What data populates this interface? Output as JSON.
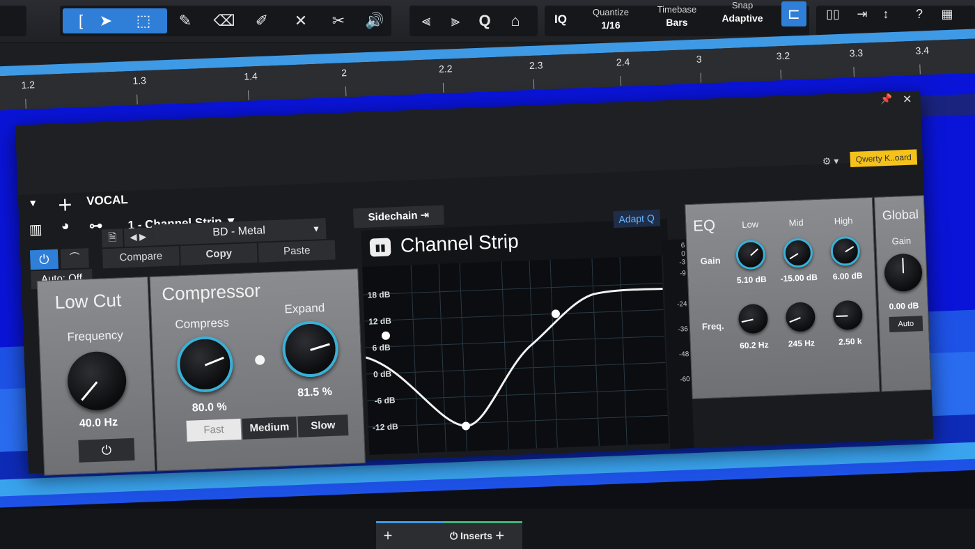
{
  "toolbar": {
    "quantize_label": "Quantize",
    "quantize_value": "1/16",
    "timebase_label": "Timebase",
    "timebase_value": "Bars",
    "snap_label": "Snap",
    "snap_value": "Adaptive",
    "iq_label": "IQ",
    "q_label": "Q"
  },
  "ruler": {
    "marks": [
      "1.2",
      "1.3",
      "1.4",
      "2",
      "2.2",
      "2.3",
      "2.4",
      "3",
      "3.2",
      "3.3",
      "3.4"
    ]
  },
  "plugin": {
    "track_name": "VOCAL",
    "plugin_selector": "1 - Channel Strip",
    "preset_name": "BD - Metal",
    "compare_label": "Compare",
    "copy_label": "Copy",
    "paste_label": "Paste",
    "auto_label": "Auto: Off",
    "sidechain_label": "Sidechain",
    "keyboard_badge": "Qwerty K..oard",
    "title": "Channel Strip",
    "adapt_q_label": "Adapt Q",
    "low_cut": {
      "title": "Low Cut",
      "frequency_label": "Frequency",
      "frequency_value": "40.0 Hz"
    },
    "compressor": {
      "title": "Compressor",
      "compress_label": "Compress",
      "compress_value": "80.0 %",
      "expand_label": "Expand",
      "expand_value": "81.5 %",
      "modes": [
        "Fast",
        "Medium",
        "Slow"
      ],
      "selected_mode": "Fast"
    },
    "eq_graph": {
      "db_labels": [
        "18 dB",
        "12 dB",
        "6 dB",
        "0 dB",
        "-6 dB",
        "-12 dB"
      ],
      "meter_labels": [
        "6",
        "0",
        "-3",
        "-9",
        "-24",
        "-36",
        "-48",
        "-60"
      ]
    },
    "eq": {
      "title": "EQ",
      "band_labels": [
        "Low",
        "Mid",
        "High"
      ],
      "gain_label": "Gain",
      "freq_label": "Freq.",
      "gain_values": [
        "5.10 dB",
        "-15.00 dB",
        "6.00 dB"
      ],
      "freq_values": [
        "60.2 Hz",
        "245 Hz",
        "2.50 k"
      ]
    },
    "global": {
      "title": "Global",
      "gain_label": "Gain",
      "gain_value": "0.00 dB",
      "auto_label": "Auto"
    }
  },
  "bottom": {
    "inserts_label": "Inserts"
  },
  "colors": {
    "accent_blue": "#2f7fd8",
    "knob_ring": "#3ab0d6",
    "track_dark_blue": "#0a14d8",
    "track_blue": "#1e52e6",
    "ruler_highlight": "#3f9ae6",
    "badge_yellow": "#f4c21b"
  }
}
